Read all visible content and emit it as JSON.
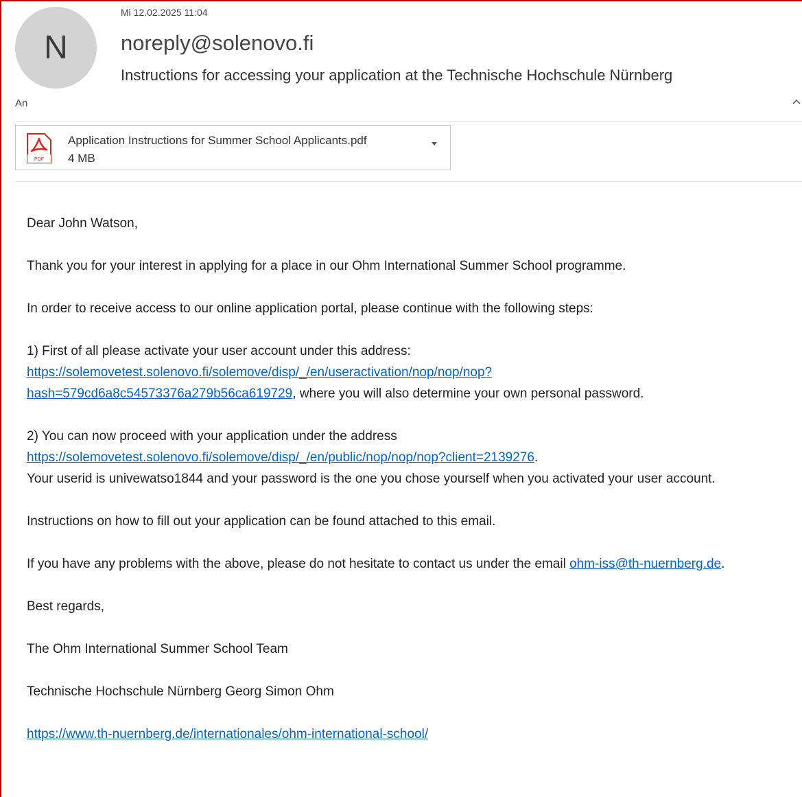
{
  "header": {
    "avatar_letter": "N",
    "date": "Mi 12.02.2025 11:04",
    "sender": "noreply@solenovo.fi",
    "subject": "Instructions for accessing your application at the Technische Hochschule Nürnberg",
    "to_label": "An",
    "collapse_icon": "chevron-up-icon"
  },
  "attachment": {
    "name": "Application Instructions for Summer School Applicants.pdf",
    "size": "4 MB",
    "icon": "pdf-icon",
    "icon_label": "PDF",
    "icon_color": "#d9251c"
  },
  "body": {
    "greeting": "Dear John Watson,",
    "thanks": "Thank you for your interest in applying for a place in our Ohm International Summer School programme.",
    "intro": "In order to receive access to our online application portal, please continue with the following steps:",
    "step1_text": "1) First of all please activate your user account under this address:",
    "step1_link_line1": "https://solemovetest.solenovo.fi/solemove/disp/_/en/useractivation/nop/nop/nop?",
    "step1_link_line2": "hash=579cd6a8c54573376a279b56ca619729",
    "step1_suffix": ", where you will also determine your own personal password.",
    "step2_text": "2) You can now proceed with your application under the address",
    "step2_link": "https://solemovetest.solenovo.fi/solemove/disp/_/en/public/nop/nop/nop?client=2139276",
    "step2_period": ".",
    "userid_text": "Your userid is univewatso1844 and your password is the one you chose yourself when you activated your user account.",
    "instructions": "Instructions on how to fill out your application can be found attached to this email.",
    "contact_text": "If you have any problems with the above, please do not hesitate to contact us under the email ",
    "contact_email": "ohm-iss@th-nuernberg.de",
    "contact_period": ".",
    "closing": "Best regards,",
    "team": "The Ohm International Summer School Team",
    "university": "Technische Hochschule Nürnberg Georg Simon Ohm",
    "website": "https://www.th-nuernberg.de/internationales/ohm-international-school/"
  },
  "colors": {
    "link": "#0563c1",
    "frame_border": "#c00000",
    "avatar_bg": "#d3d3d3"
  }
}
